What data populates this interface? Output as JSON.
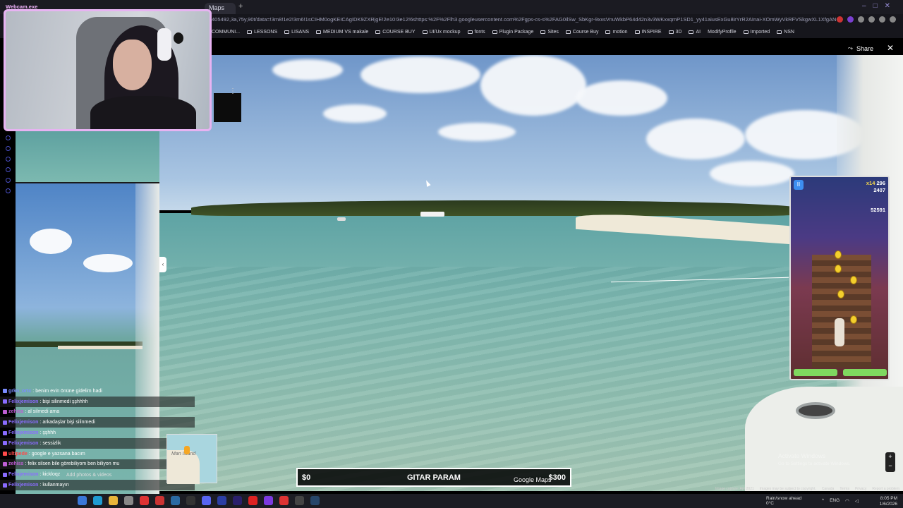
{
  "browser": {
    "tab_title": "Maps",
    "webcam_label": "Webcam.exe",
    "url": "405492,3a,75y,90t/data=!3m8!1e2!3m6!1sCIHM0ogKEICAgIDK9ZXRjgE!2e10!3e12!6shttps:%2F%2Flh3.googleusercontent.com%2Fgps-cs-s%2FAG0ilSw_SbKgr-9xxsVnuWkbP64d42n3v3WKxxqmP1SD1_yy41aiusExGu8irYrR2AInai-XOmWyVkRFVSkgwXL1XfgANOtPQvBmFv8Bh_PR-trkPa",
    "bookmarks": [
      "COMMUNI...",
      "LESSONS",
      "LISANS",
      "MEDIUM VS makale",
      "COURSE BUY",
      "UI/Ux mockup",
      "fonts",
      "Plugin Package",
      "Sites",
      "Course Buy",
      "motion",
      "INSPIRE",
      "3D",
      "AI",
      "ModifyProfile",
      "Imported",
      "NSN"
    ]
  },
  "viewer": {
    "share_label": "Share",
    "close_icon": "close-icon",
    "image_capture": "Image capture: Apr 2021",
    "copyright": "Images may be subject to copyright.",
    "footer_links": [
      "Canada",
      "Terms",
      "Privacy",
      "Report a problem"
    ],
    "google_maps_logo": "Google Maps",
    "add_photos": "Add photos & videos",
    "minimap_label": "Man Island",
    "activate_windows": [
      "Activate Windows",
      "Go to Settings to activate Windows."
    ]
  },
  "game": {
    "multiplier": "x14",
    "score_top": "296",
    "score_mid": "2407",
    "high_score": "52591"
  },
  "donation": {
    "low": "$0",
    "title": "GITAR PARAM",
    "high": "$300"
  },
  "chat": [
    {
      "user": "grkn_ortc",
      "msg": "benim evin önüne gidelim hadi",
      "color": "#7b8cff"
    },
    {
      "user": "Felixjemison",
      "msg": "bişi silinmedi şşhhhh",
      "color": "#8a6cff"
    },
    {
      "user": "zehiss",
      "msg": "al silmedi ama",
      "color": "#c05fd6"
    },
    {
      "user": "Felixjemison",
      "msg": "arkadaşlar bişi silinmedi",
      "color": "#8a6cff"
    },
    {
      "user": "Felixjemison",
      "msg": "şşhhh",
      "color": "#8a6cff"
    },
    {
      "user": "Felixjemison",
      "msg": "sessizlik",
      "color": "#8a6cff"
    },
    {
      "user": "ultipede",
      "msg": "google e yazsana bacım",
      "color": "#ff4a4a"
    },
    {
      "user": "zehiss",
      "msg": "felix silsen bile görebiliyom ben biliyon mu",
      "color": "#c05fd6"
    },
    {
      "user": "Felixjemison",
      "msg": "kickloqz",
      "color": "#8a6cff"
    },
    {
      "user": "Felixjemison",
      "msg": "kullanmayın",
      "color": "#8a6cff"
    }
  ],
  "taskbar": {
    "weather_title": "Rain/snow ahead",
    "weather_temp": "0°C",
    "lang": "ENG",
    "time": "8:05 PM",
    "date": "1/6/2026"
  }
}
